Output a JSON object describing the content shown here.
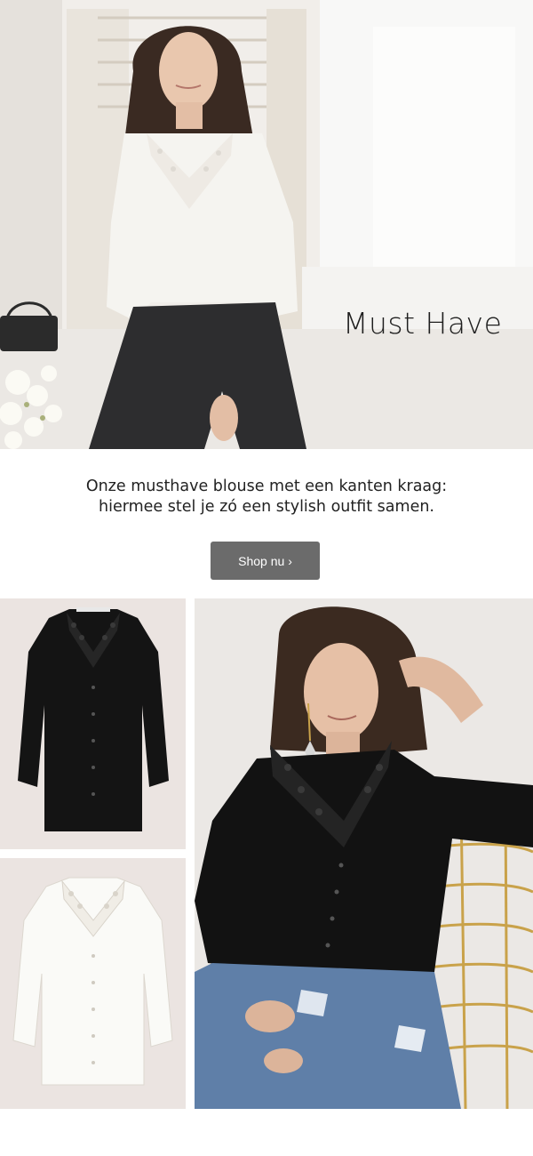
{
  "hero": {
    "title": "Must Have"
  },
  "intro": {
    "line1": "Onze musthave blouse met een kanten kraag:",
    "line2": "hiermee stel je zó een stylish outfit samen."
  },
  "cta": {
    "label": "Shop nu ›"
  },
  "colors": {
    "cta_bg": "#6b6b6b",
    "tile_bg": "#ebe4e1",
    "text": "#1a1a1a"
  }
}
